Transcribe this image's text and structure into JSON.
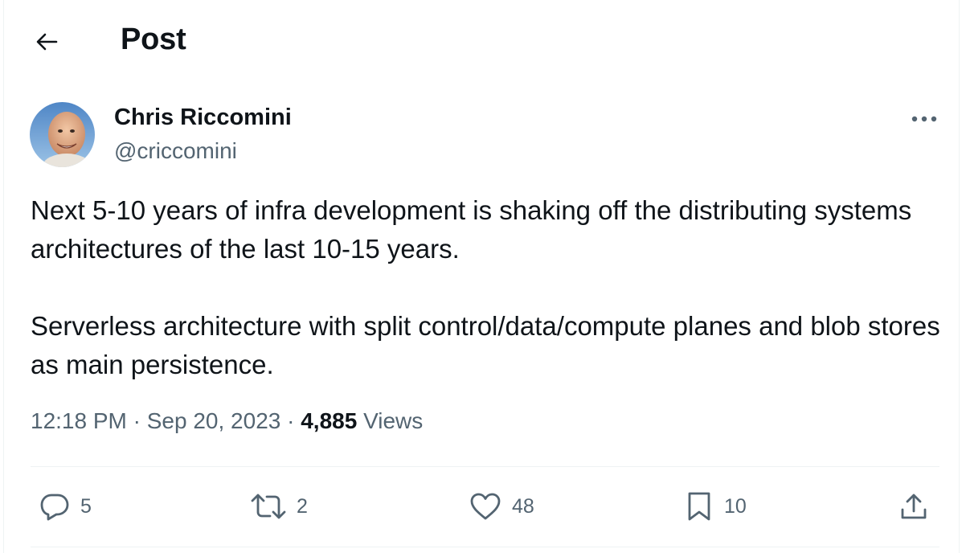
{
  "header": {
    "title": "Post"
  },
  "author": {
    "name": "Chris Riccomini",
    "handle": "@criccomini"
  },
  "tweet": {
    "paragraphs": [
      "Next 5-10 years of infra development is shaking off the distributing systems architectures of the last 10-15 years.",
      "Serverless architecture with split control/data/compute planes and blob stores as main persistence."
    ]
  },
  "meta": {
    "time": "12:18 PM",
    "separator": "·",
    "date": "Sep 20, 2023",
    "views_count": "4,885",
    "views_label": "Views"
  },
  "actions": {
    "reply": {
      "icon": "reply-icon",
      "count": "5"
    },
    "repost": {
      "icon": "repost-icon",
      "count": "2"
    },
    "like": {
      "icon": "heart-icon",
      "count": "48"
    },
    "bookmark": {
      "icon": "bookmark-icon",
      "count": "10"
    },
    "share": {
      "icon": "share-icon"
    }
  },
  "colors": {
    "text": "#0f1419",
    "secondary": "#536471",
    "divider": "#eff3f4"
  }
}
